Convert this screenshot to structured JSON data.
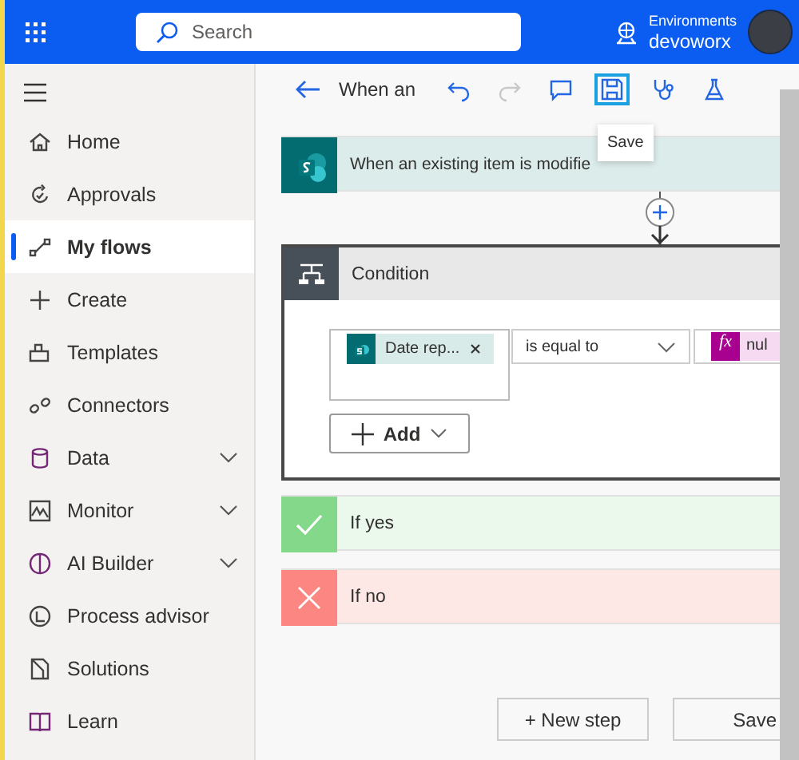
{
  "top_bar": {
    "search": {
      "placeholder": "Search"
    },
    "environment_label": "Environments",
    "environment_name": "devoworx"
  },
  "sidebar": {
    "items": [
      {
        "label": "Home",
        "selected": false,
        "expandable": false
      },
      {
        "label": "Approvals",
        "selected": false,
        "expandable": false
      },
      {
        "label": "My flows",
        "selected": true,
        "expandable": false
      },
      {
        "label": "Create",
        "selected": false,
        "expandable": false
      },
      {
        "label": "Templates",
        "selected": false,
        "expandable": false
      },
      {
        "label": "Connectors",
        "selected": false,
        "expandable": false
      },
      {
        "label": "Data",
        "selected": false,
        "expandable": true
      },
      {
        "label": "Monitor",
        "selected": false,
        "expandable": true
      },
      {
        "label": "AI Builder",
        "selected": false,
        "expandable": true
      },
      {
        "label": "Process advisor",
        "selected": false,
        "expandable": false
      },
      {
        "label": "Solutions",
        "selected": false,
        "expandable": false
      },
      {
        "label": "Learn",
        "selected": false,
        "expandable": false
      }
    ]
  },
  "toolbar": {
    "flow_name": "When an",
    "buttons": [
      {
        "disabled": false,
        "highlighted": false
      },
      {
        "disabled": true,
        "highlighted": false
      },
      {
        "disabled": false,
        "highlighted": false
      },
      {
        "disabled": false,
        "highlighted": true
      },
      {
        "disabled": false,
        "highlighted": false
      },
      {
        "disabled": false,
        "highlighted": false
      }
    ],
    "tooltip": "Save"
  },
  "trigger": {
    "title": "When an existing item is modifie"
  },
  "condition": {
    "title": "Condition",
    "token": "Date rep...",
    "operator": "is equal to",
    "value_icon": "fx",
    "value_token": "nul",
    "add_button": "Add"
  },
  "branches": [
    {
      "kind": "yes",
      "label": "If yes"
    },
    {
      "kind": "no",
      "label": "If no"
    }
  ],
  "footer_buttons": [
    "+ New step",
    "Save"
  ]
}
